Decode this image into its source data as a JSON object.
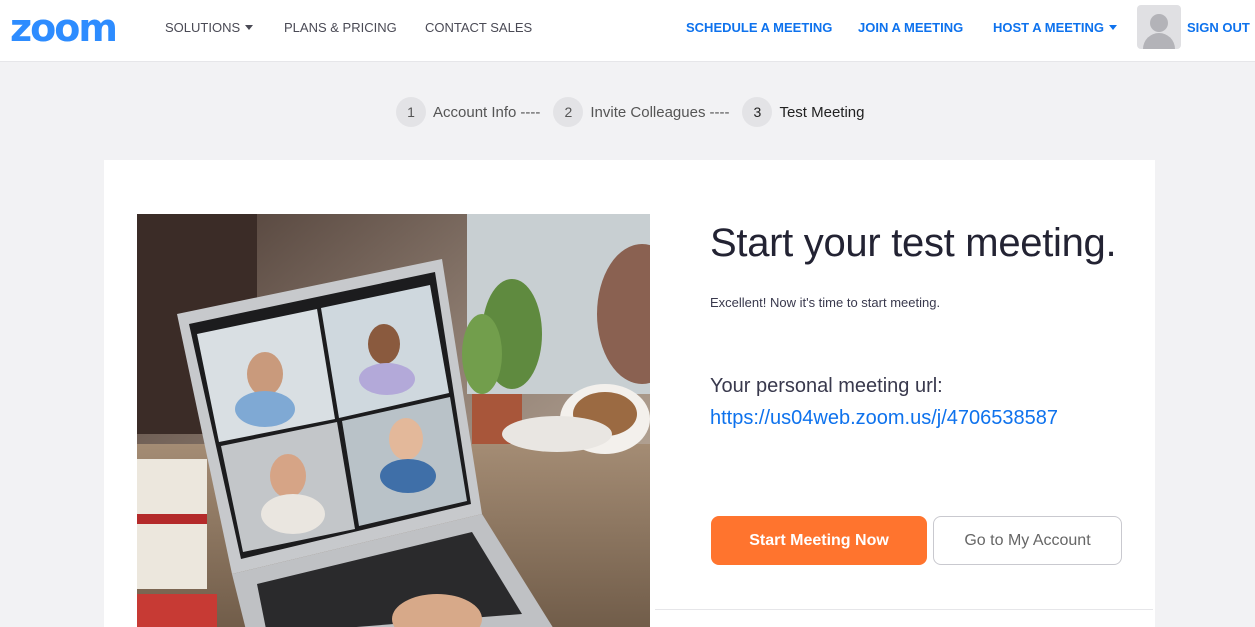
{
  "nav": {
    "logo": "zoom",
    "solutions": "SOLUTIONS",
    "plans_pricing": "PLANS & PRICING",
    "contact_sales": "CONTACT SALES",
    "schedule_meeting": "SCHEDULE A MEETING",
    "join_meeting": "JOIN A MEETING",
    "host_meeting": "HOST A MEETING",
    "sign_out": "SIGN OUT"
  },
  "stepper": {
    "steps": [
      {
        "number": "1",
        "label": "Account Info",
        "separator": "----"
      },
      {
        "number": "2",
        "label": "Invite Colleagues",
        "separator": "----"
      },
      {
        "number": "3",
        "label": "Test Meeting"
      }
    ]
  },
  "main": {
    "headline": "Start your test meeting.",
    "subtext": "Excellent! Now it's time to start meeting.",
    "url_label": "Your personal meeting url:",
    "url": "https://us04web.zoom.us/j/4706538587",
    "start_button": "Start Meeting Now",
    "account_button": "Go to My Account"
  },
  "colors": {
    "brand_blue": "#2d8cff",
    "link_blue": "#0e72ed",
    "primary_orange": "#ff742e"
  },
  "icons": {
    "caret": "chevron-down-icon",
    "avatar": "user-avatar-icon"
  }
}
